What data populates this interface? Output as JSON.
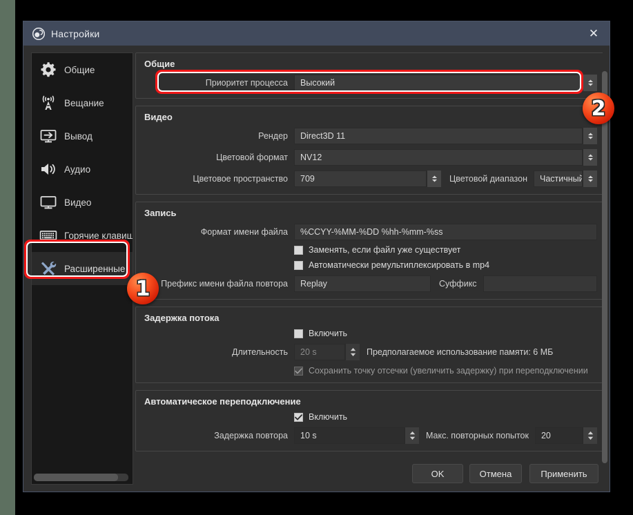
{
  "window": {
    "title": "Настройки",
    "app_icon": "obs-logo-icon",
    "close_label": "✕"
  },
  "sidebar": {
    "items": [
      {
        "label": "Общие",
        "icon": "gear-icon",
        "selected": false
      },
      {
        "label": "Вещание",
        "icon": "broadcast-icon",
        "selected": false
      },
      {
        "label": "Вывод",
        "icon": "output-icon",
        "selected": false
      },
      {
        "label": "Аудио",
        "icon": "speaker-icon",
        "selected": false
      },
      {
        "label": "Видео",
        "icon": "monitor-icon",
        "selected": false
      },
      {
        "label": "Горячие клавиши",
        "icon": "keyboard-icon",
        "selected": false
      },
      {
        "label": "Расширенные",
        "icon": "tools-icon",
        "selected": true
      }
    ]
  },
  "groups": {
    "general": {
      "title": "Общие",
      "process_priority": {
        "label": "Приоритет процесса",
        "value": "Высокий"
      }
    },
    "video": {
      "title": "Видео",
      "renderer": {
        "label": "Рендер",
        "value": "Direct3D 11"
      },
      "color_format": {
        "label": "Цветовой формат",
        "value": "NV12"
      },
      "color_space": {
        "label": "Цветовое пространство",
        "value": "709"
      },
      "color_range": {
        "label": "Цветовой диапазон",
        "value": "Частичный"
      }
    },
    "recording": {
      "title": "Запись",
      "filename_format": {
        "label": "Формат имени файла",
        "value": "%CCYY-%MM-%DD %hh-%mm-%ss"
      },
      "overwrite": {
        "label": "Заменять, если файл уже существует",
        "checked": false
      },
      "remux_mp4": {
        "label": "Автоматически ремультиплексировать в mp4",
        "checked": false
      },
      "replay_prefix": {
        "label": "Префикс имени файла повтора",
        "value": "Replay"
      },
      "replay_suffix": {
        "label": "Суффикс",
        "value": ""
      }
    },
    "stream_delay": {
      "title": "Задержка потока",
      "enable": {
        "label": "Включить",
        "checked": false
      },
      "duration": {
        "label": "Длительность",
        "value": "20 s"
      },
      "memory_note": "Предполагаемое использование памяти: 6 МБ",
      "preserve": {
        "label": "Сохранить точку отсечки (увеличить задержку) при переподключении",
        "checked": true
      }
    },
    "auto_reconnect": {
      "title": "Автоматическое переподключение",
      "enable": {
        "label": "Включить",
        "checked": true
      },
      "retry_delay": {
        "label": "Задержка повтора",
        "value": "10 s"
      },
      "max_retries": {
        "label": "Макс. повторных попыток",
        "value": "20"
      }
    }
  },
  "footer": {
    "ok": "OK",
    "cancel": "Отмена",
    "apply": "Применить"
  },
  "annotations": {
    "badge_one": "1",
    "badge_two": "2",
    "highlight_color": "#f01818"
  }
}
